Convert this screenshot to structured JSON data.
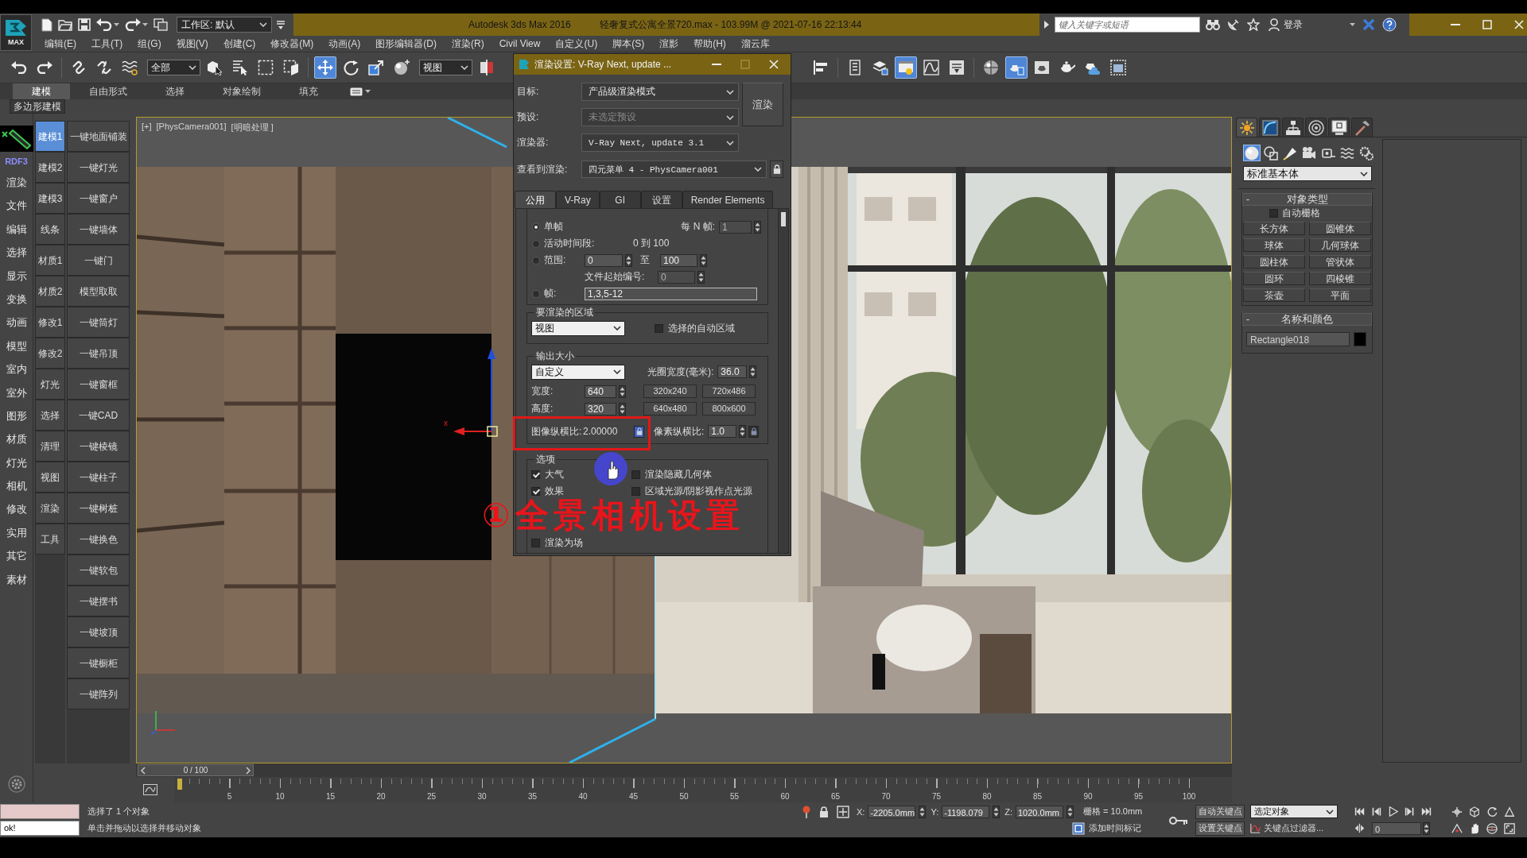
{
  "title_bar": {
    "workspace": "工作区: 默认",
    "title": "Autodesk 3ds Max 2016",
    "document": "轻奢复式公寓全景720.max - 103.99M @ 2021-07-16 22:13:44",
    "search": {
      "placeholder": "键入关键字或短语"
    },
    "sign_in": "登录"
  },
  "logo": "MAX",
  "menu_bar": [
    "编辑(E)",
    "工具(T)",
    "组(G)",
    "视图(V)",
    "创建(C)",
    "修改器(M)",
    "动画(A)",
    "图形编辑器(D)",
    "渲染(R)",
    "Civil View",
    "自定义(U)",
    "脚本(S)",
    "渲影",
    "帮助(H)",
    "溜云库"
  ],
  "main_toolbar": {
    "left": [
      {
        "kind": "button",
        "active": false
      },
      {
        "kind": "button",
        "active": false
      },
      {
        "kind": "separator"
      },
      {
        "kind": "button",
        "active": false
      },
      {
        "kind": "button",
        "active": false
      },
      {
        "kind": "button",
        "active": false
      },
      {
        "kind": "dropdown",
        "value": "全部"
      },
      {
        "kind": "button",
        "active": false
      },
      {
        "kind": "button",
        "active": false
      },
      {
        "kind": "button",
        "active": false
      },
      {
        "kind": "button",
        "active": false
      },
      {
        "kind": "separator"
      },
      {
        "kind": "button",
        "active": true
      },
      {
        "kind": "button",
        "active": false
      },
      {
        "kind": "button",
        "active": false
      },
      {
        "kind": "button",
        "active": false
      },
      {
        "kind": "dropdown",
        "value": "视图"
      },
      {
        "kind": "button",
        "active": false
      }
    ],
    "right": [
      {
        "kind": "button",
        "active": false
      },
      {
        "kind": "separator"
      },
      {
        "kind": "button",
        "active": false
      },
      {
        "kind": "button",
        "active": false
      },
      {
        "kind": "button",
        "active": true
      },
      {
        "kind": "button",
        "active": false
      },
      {
        "kind": "button",
        "active": false
      },
      {
        "kind": "separator"
      },
      {
        "kind": "button",
        "active": false
      },
      {
        "kind": "button",
        "active": true
      },
      {
        "kind": "button",
        "active": false
      },
      {
        "kind": "button",
        "active": false
      },
      {
        "kind": "button",
        "active": false
      },
      {
        "kind": "button",
        "active": false
      }
    ]
  },
  "ribbon": {
    "tabs": [
      {
        "label": "建模",
        "selected": true
      },
      {
        "label": "自由形式",
        "selected": false
      },
      {
        "label": "选择",
        "selected": false
      },
      {
        "label": "对象绘制",
        "selected": false
      },
      {
        "label": "填充",
        "selected": false
      }
    ],
    "panel": "多边形建模"
  },
  "plugin_menu": {
    "header": "RDF3",
    "items": [
      "渲染",
      "文件",
      "编辑",
      "选择",
      "显示",
      "变换",
      "动画",
      "模型",
      "室内",
      "室外",
      "图形",
      "材质",
      "灯光",
      "相机",
      "修改",
      "实用",
      "其它",
      "素材"
    ]
  },
  "plugin_tabs": [
    {
      "label": "建模1",
      "selected": true
    },
    {
      "label": "建模2",
      "selected": false
    },
    {
      "label": "建模3",
      "selected": false
    },
    {
      "label": "线条",
      "selected": false
    },
    {
      "label": "材质1",
      "selected": false
    },
    {
      "label": "材质2",
      "selected": false
    },
    {
      "label": "修改1",
      "selected": false
    },
    {
      "label": "修改2",
      "selected": false
    },
    {
      "label": "灯光",
      "selected": false
    },
    {
      "label": "选择",
      "selected": false
    },
    {
      "label": "清理",
      "selected": false
    },
    {
      "label": "视图",
      "selected": false
    },
    {
      "label": "渲染",
      "selected": false
    },
    {
      "label": "工具",
      "selected": false
    }
  ],
  "plugin_buttons": [
    "一键地面铺装",
    "一键灯光",
    "一键窗户",
    "一键墙体",
    "一键门",
    "模型取取",
    "一键筒灯",
    "一键吊顶",
    "一键窗框",
    "一键CAD",
    "一键棱镜",
    "一键柱子",
    "一键树桩",
    "一键换色",
    "一键软包",
    "一键摆书",
    "一键坡顶",
    "一键橱柜",
    "一键阵列"
  ],
  "viewport": {
    "labels": [
      "[+]",
      "[PhysCamera001]",
      "[明暗处理 ]"
    ],
    "active": true,
    "gizmo_label": "x"
  },
  "render_dialog": {
    "title": "渲染设置: V-Ray Next, update ...",
    "fields": [
      {
        "label": "目标:",
        "value": "产品级渲染模式",
        "disabled": false
      },
      {
        "label": "预设:",
        "value": "未选定预设",
        "disabled": true
      },
      {
        "label": "渲染器:",
        "value": "V-Ray Next, update 3.1",
        "disabled": false
      }
    ],
    "view_to_render": {
      "label": "查看到渲染:",
      "value": "四元菜单 4 - PhysCamera001"
    },
    "render_button": "渲染",
    "tabs": [
      {
        "label": "公用",
        "selected": true
      },
      {
        "label": "V-Ray",
        "selected": false
      },
      {
        "label": "GI",
        "selected": false
      },
      {
        "label": "设置",
        "selected": false
      },
      {
        "label": "Render Elements",
        "selected": false
      }
    ],
    "time_output": {
      "modes": [
        {
          "label": "单帧",
          "selected": true
        },
        {
          "label": "活动时间段:",
          "selected": false
        },
        {
          "label": "范围:",
          "selected": false
        },
        {
          "label": "帧:",
          "selected": false
        }
      ],
      "every_nth": {
        "label": "每 N 帧:",
        "value": "1",
        "disabled": true
      },
      "active_segment": "0 到 100",
      "range_from": "0",
      "range_to_label": "至",
      "range_to": "100",
      "file_number": {
        "label": "文件起始编号:",
        "value": "0",
        "disabled": true
      },
      "frames": "1,3,5-12"
    },
    "area": {
      "title": "要渲染的区域",
      "selection": "视图",
      "auto_region": {
        "label": "选择的自动区域",
        "checked": false
      }
    },
    "output_size": {
      "title": "输出大小",
      "preset": "自定义",
      "aperture": {
        "label": "光圈宽度(毫米):",
        "value": "36.0"
      },
      "width": {
        "label": "宽度:",
        "value": "640"
      },
      "height": {
        "label": "高度:",
        "value": "320"
      },
      "sizes": [
        "320x240",
        "720x486",
        "640x480",
        "800x600"
      ],
      "image_aspect": {
        "label": "图像纵横比:",
        "value": "2.00000",
        "locked": true
      },
      "pixel_aspect": {
        "label": "像素纵横比:",
        "value": "1.0",
        "locked": false
      }
    },
    "options": {
      "title": "选项",
      "items": [
        {
          "label": "大气",
          "checked": true
        },
        {
          "label": "渲染隐藏几何体",
          "checked": false
        },
        {
          "label": "效果",
          "checked": true
        },
        {
          "label": "区域光源/阴影视作点光源",
          "checked": false
        },
        {
          "label": "渲染为场",
          "checked": false
        }
      ]
    }
  },
  "command_panel": {
    "tabs": [
      {
        "selected": true
      },
      {
        "selected": false
      },
      {
        "selected": false
      },
      {
        "selected": false
      },
      {
        "selected": false
      },
      {
        "selected": false
      }
    ],
    "categories": [
      {
        "selected": true
      },
      {
        "selected": false
      },
      {
        "selected": false
      },
      {
        "selected": false
      },
      {
        "selected": false
      },
      {
        "selected": false
      },
      {
        "selected": false
      }
    ],
    "object_class": "标准基本体",
    "object_type": {
      "toggle": "-",
      "title": "对象类型",
      "autogrid": {
        "label": "自动栅格",
        "checked": false
      },
      "buttons": [
        "长方体",
        "圆锥体",
        "球体",
        "几何球体",
        "圆柱体",
        "管状体",
        "圆环",
        "四棱锥",
        "茶壶",
        "平面"
      ]
    },
    "name_and_color": {
      "toggle": "-",
      "title": "名称和颜色",
      "name": "Rectangle018",
      "color": "#000000"
    }
  },
  "time_slider": {
    "position": "0 / 100",
    "level": 0
  },
  "track_bar": {
    "ticks": [
      "5",
      "10",
      "15",
      "20",
      "25",
      "30",
      "35",
      "40",
      "45",
      "50",
      "55",
      "60",
      "65",
      "70",
      "75",
      "80",
      "85",
      "90",
      "95",
      "100"
    ]
  },
  "status_bar": {
    "listener_output": "ok!",
    "selection": "选择了 1 个对象",
    "prompt": "单击并拖动以选择并移动对象",
    "coordinates": [
      {
        "axis": "X:",
        "value": "-2205.0mm"
      },
      {
        "axis": "Y:",
        "value": "-1198.079"
      },
      {
        "axis": "Z:",
        "value": "1020.0mm"
      }
    ],
    "grid": "栅格 = 10.0mm",
    "time_tag": "添加时间标记",
    "auto_key": "自动关键点",
    "set_key": "设置关键点",
    "key_target": "选定对象",
    "key_filters": "关键点过滤器...",
    "current_frame": "0"
  },
  "annotation": {
    "caption": "①全景相机设置"
  }
}
